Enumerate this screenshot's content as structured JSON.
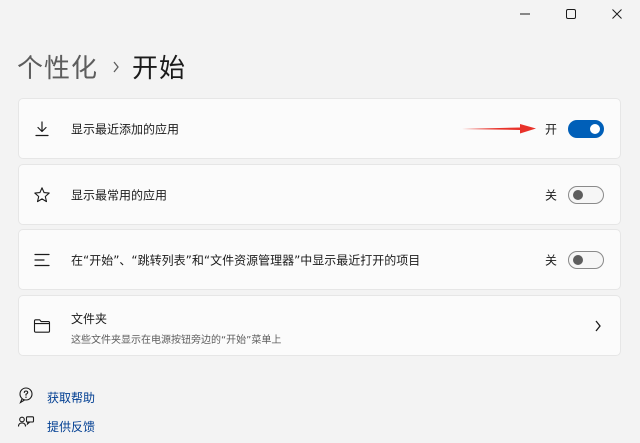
{
  "window": {
    "controls": [
      {
        "name": "minimize-button",
        "icon": "minimize-icon"
      },
      {
        "name": "maximize-button",
        "icon": "maximize-icon"
      },
      {
        "name": "close-button",
        "icon": "close-icon"
      }
    ]
  },
  "breadcrumb": {
    "parent": "个性化",
    "current": "开始"
  },
  "settings": [
    {
      "icon": "download-icon",
      "label": "显示最近添加的应用",
      "state": "开",
      "on": true
    },
    {
      "icon": "star-icon",
      "label": "显示最常用的应用",
      "state": "关",
      "on": false
    },
    {
      "icon": "list-icon",
      "label": "在“开始”、“跳转列表”和“文件资源管理器”中显示最近打开的项目",
      "state": "关",
      "on": false
    }
  ],
  "folders": {
    "icon": "folder-icon",
    "title": "文件夹",
    "subtitle": "这些文件夹显示在电源按钮旁边的“开始”菜单上"
  },
  "links": [
    {
      "icon": "help-icon",
      "label": "获取帮助"
    },
    {
      "icon": "feedback-icon",
      "label": "提供反馈"
    }
  ],
  "colors": {
    "accent": "#005fb8",
    "annotation_arrow": "#e8322a",
    "link": "#003e92"
  }
}
